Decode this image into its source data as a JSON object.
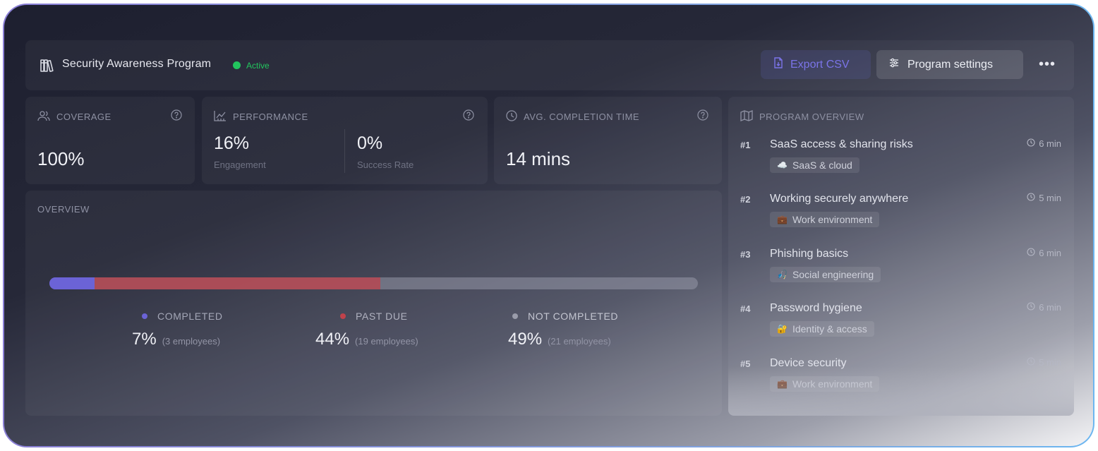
{
  "header": {
    "title": "Security Awareness Program",
    "status": "Active",
    "export_label": "Export CSV",
    "settings_label": "Program settings",
    "more_label": "•••"
  },
  "colors": {
    "active": "#22c55e",
    "completed": "#6b63d6",
    "past_due": "#c0424b",
    "not_completed": "#9a9caa"
  },
  "coverage": {
    "label": "COVERAGE",
    "value": "100%"
  },
  "performance": {
    "label": "PERFORMANCE",
    "engagement_value": "16%",
    "engagement_label": "Engagement",
    "success_value": "0%",
    "success_label": "Success Rate"
  },
  "avg_time": {
    "label": "AVG. COMPLETION TIME",
    "value": "14 mins"
  },
  "overview": {
    "title": "OVERVIEW",
    "segments": [
      {
        "key": "completed",
        "label": "COMPLETED",
        "percent": 7,
        "percent_text": "7%",
        "employees": "(3 employees)"
      },
      {
        "key": "past_due",
        "label": "PAST DUE",
        "percent": 44,
        "percent_text": "44%",
        "employees": "(19 employees)"
      },
      {
        "key": "not_completed",
        "label": "NOT COMPLETED",
        "percent": 49,
        "percent_text": "49%",
        "employees": "(21 employees)"
      }
    ]
  },
  "program_overview": {
    "title": "PROGRAM OVERVIEW",
    "modules": [
      {
        "num": "#1",
        "title": "SaaS access & sharing risks",
        "time": "6 min",
        "tag": "SaaS & cloud",
        "tag_icon": "☁️"
      },
      {
        "num": "#2",
        "title": "Working securely anywhere",
        "time": "5 min",
        "tag": "Work environment",
        "tag_icon": "💼"
      },
      {
        "num": "#3",
        "title": "Phishing basics",
        "time": "6 min",
        "tag": "Social engineering",
        "tag_icon": "🎣"
      },
      {
        "num": "#4",
        "title": "Password hygiene",
        "time": "6 min",
        "tag": "Identity & access",
        "tag_icon": "🔐"
      },
      {
        "num": "#5",
        "title": "Device security",
        "time": "5 min",
        "tag": "Work environment",
        "tag_icon": "💼"
      }
    ]
  }
}
